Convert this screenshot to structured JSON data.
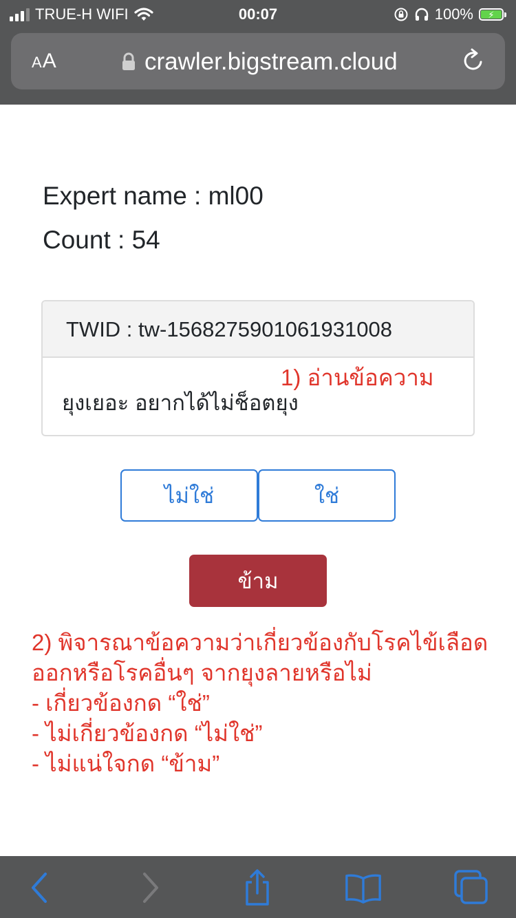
{
  "status_bar": {
    "carrier": "TRUE-H WIFI",
    "time": "00:07",
    "battery_percent": "100%",
    "battery_level": 1.0,
    "icons": [
      "signal-icon",
      "wifi-icon",
      "orientation-lock-icon",
      "headphones-icon",
      "battery-charging-icon"
    ]
  },
  "address_bar": {
    "text_size_label_small": "A",
    "text_size_label_large": "A",
    "url": "crawler.bigstream.cloud",
    "icons": [
      "lock-icon",
      "reload-icon"
    ]
  },
  "expert": {
    "label": "Expert name : ml00",
    "count_label": "Count : 54"
  },
  "tweet_card": {
    "header": "TWID : tw-1568275901061931008",
    "message": "ยุงเยอะ อยากได้ไม่ช็อตยุง"
  },
  "annotation_1": "1) อ่านข้อความ",
  "buttons": {
    "no": "ไม่ใช่",
    "yes": "ใช่",
    "skip": "ข้าม"
  },
  "annotation_2": {
    "lines": [
      "2) พิจารณาข้อความว่าเกี่ยวข้องกับโรคไข้เลือด",
      "ออกหรือโรคอื่นๆ จากยุงลายหรือไม่",
      "- เกี่ยวข้องกด “ใช่”",
      "- ไม่เกี่ยวข้องกด “ไม่ใช่”",
      "- ไม่แน่ใจกด “ข้าม”"
    ]
  },
  "colors": {
    "chrome": "#555657",
    "primary": "#2f7bd8",
    "danger": "#a8333c",
    "annotation": "#e0352b"
  },
  "toolbar_icons": [
    "back-icon",
    "forward-icon",
    "share-icon",
    "bookmarks-icon",
    "tabs-icon"
  ]
}
